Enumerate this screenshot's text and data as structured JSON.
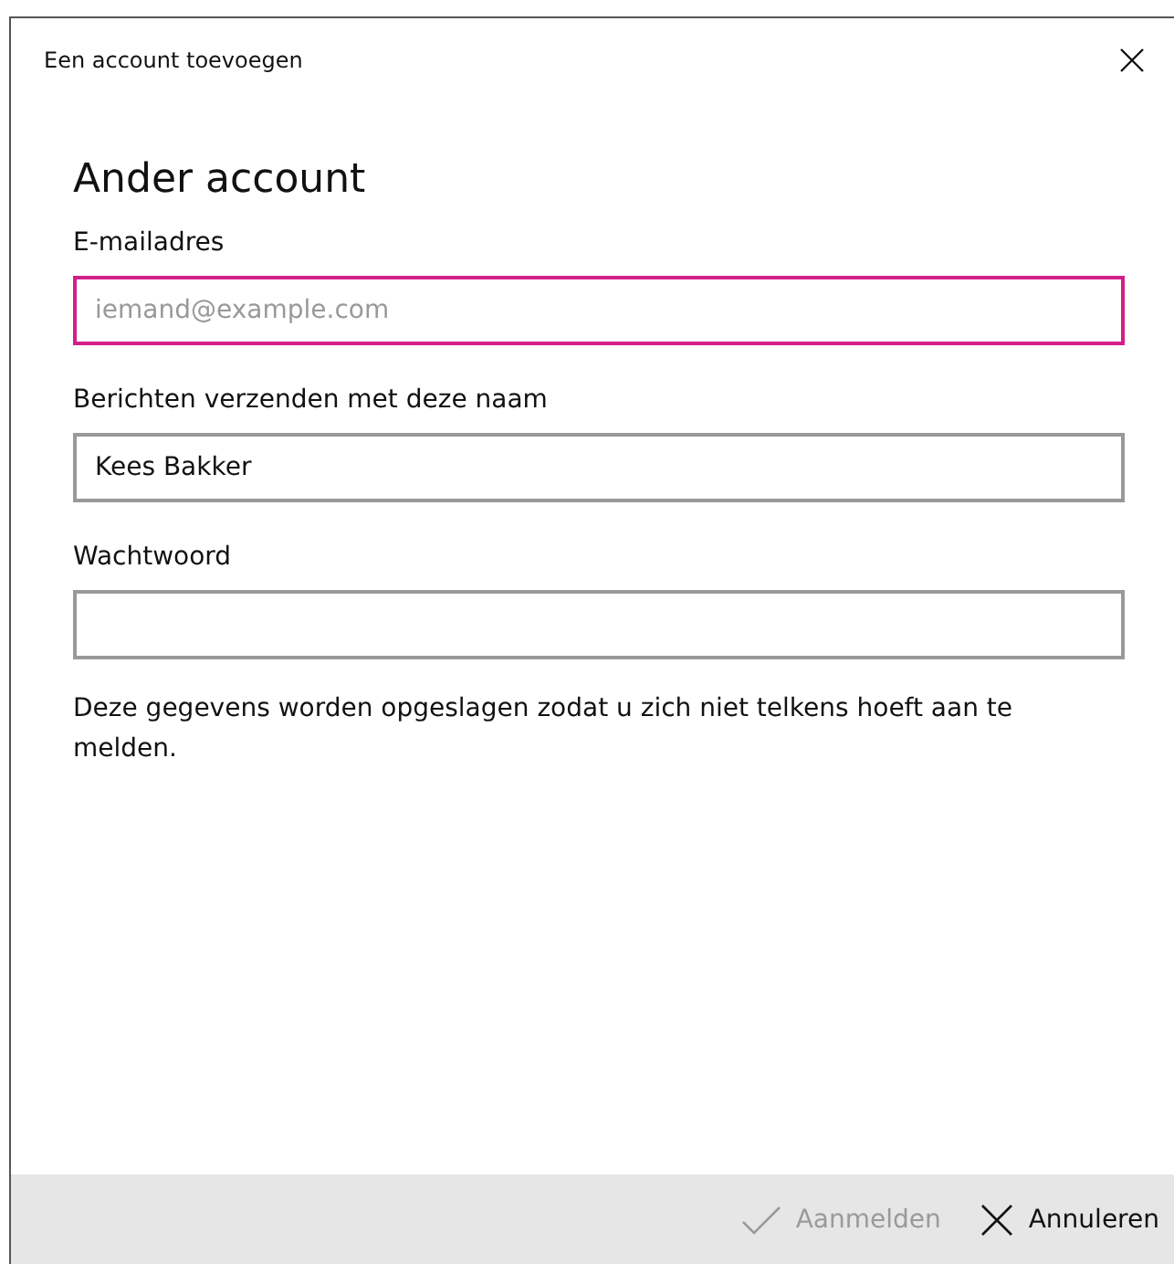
{
  "window": {
    "title": "Een account toevoegen"
  },
  "heading": "Ander account",
  "fields": [
    {
      "label": "E-mailadres",
      "placeholder": "iemand@example.com",
      "focused": true
    },
    {
      "label": "Berichten verzenden met deze naam",
      "value": "Kees Bakker",
      "focused": false
    },
    {
      "label": "Wachtwoord",
      "focused": false
    }
  ],
  "note": "Deze gegevens worden opgeslagen zodat u zich niet telkens hoeft aan te melden.",
  "buttons": [
    {
      "kind": "check",
      "label": "Aanmelden",
      "disabled": true
    },
    {
      "kind": "cancel",
      "label": "Annuleren",
      "disabled": false
    }
  ]
}
